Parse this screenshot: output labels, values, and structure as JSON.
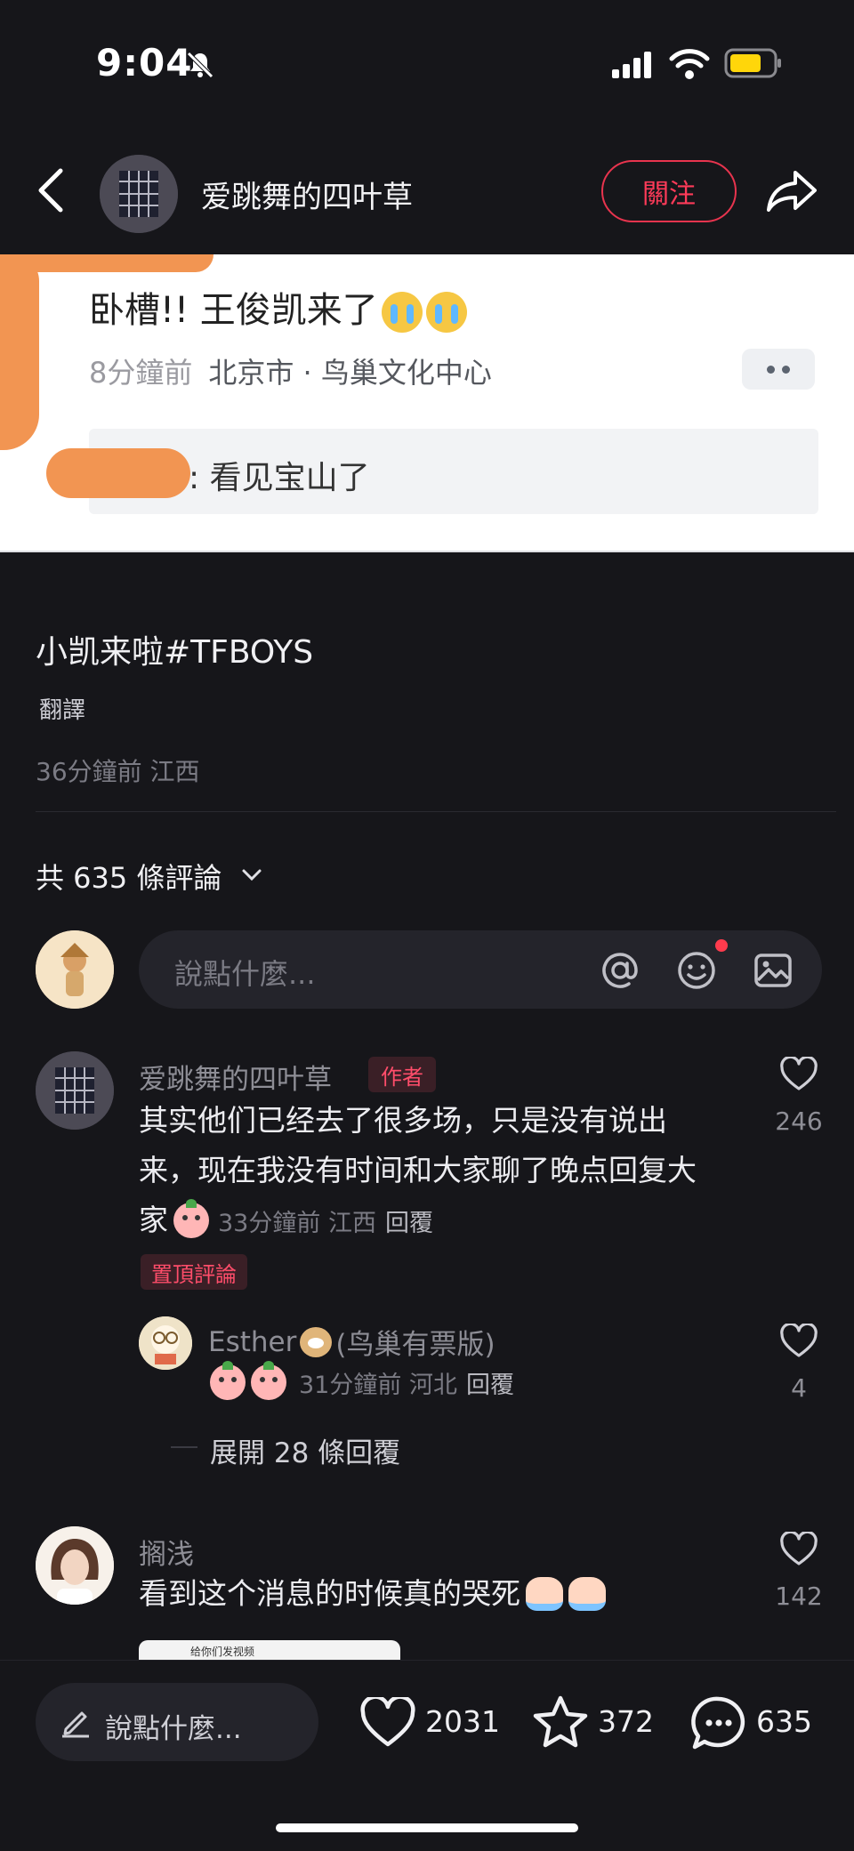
{
  "status_bar": {
    "time": "9:04"
  },
  "header": {
    "author_name": "爱跳舞的四叶草",
    "follow_label": "關注"
  },
  "embedded_screenshot": {
    "title": "卧槽!!  王俊凯来了",
    "time": "8分鐘前",
    "location": "北京市 · 鸟巢文化中心",
    "reply_text": ": 看见宝山了"
  },
  "post": {
    "text": "小凯来啦#TFBOYS",
    "translate_label": "翻譯",
    "meta": "36分鐘前 江西",
    "comment_count_label": "共 635 條評論"
  },
  "comment_input": {
    "placeholder": "說點什麼..."
  },
  "comments": [
    {
      "name": "爱跳舞的四叶草",
      "tag": "作者",
      "text_line1": "其实他们已经去了很多场，只是没有说出",
      "text_line2": "来，现在我没有时间和大家聊了晚点回复大",
      "text_line3": "家",
      "meta": "33分鐘前 江西",
      "reply_label": "回覆",
      "likes": "246",
      "pinned_label": "置頂評論"
    },
    {
      "name": "Esther",
      "name_suffix": "(鸟巢有票版)",
      "meta": "31分鐘前 河北",
      "reply_label": "回覆",
      "likes": "4"
    },
    {
      "name": "搁浅",
      "text": "看到这个消息的时候真的哭死",
      "likes": "142",
      "image_caption": "给你们发视频"
    }
  ],
  "expand_replies_label": "展開 28 條回覆",
  "bottom_bar": {
    "placeholder": "說點什麼...",
    "likes": "2031",
    "stars": "372",
    "comments": "635"
  },
  "colors": {
    "accent": "#ff3b59",
    "background": "#16161a"
  }
}
